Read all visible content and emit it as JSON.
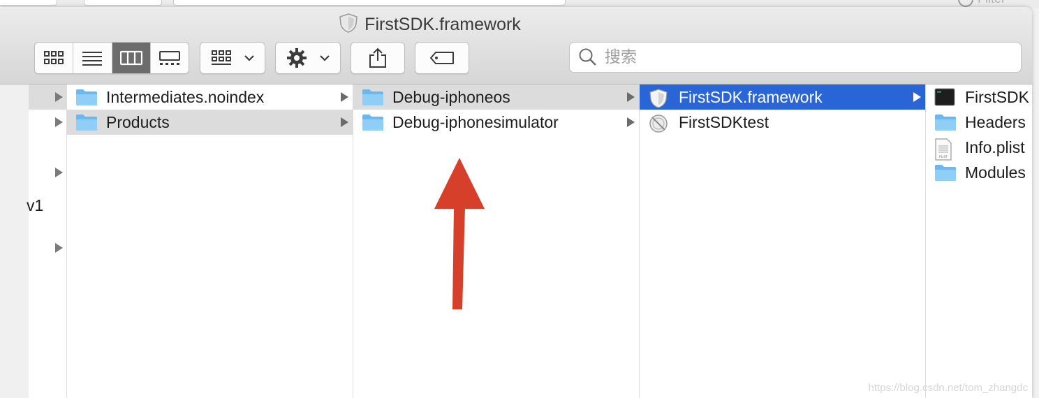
{
  "window": {
    "title": "FirstSDK.framework"
  },
  "background": {
    "filter_label": "Filter"
  },
  "toolbar": {
    "view_modes": [
      {
        "name": "icon-view",
        "active": false
      },
      {
        "name": "list-view",
        "active": false
      },
      {
        "name": "column-view",
        "active": true
      },
      {
        "name": "gallery-view",
        "active": false
      }
    ],
    "search_placeholder": "搜索"
  },
  "sidebar": {
    "partial_text": "v1"
  },
  "columns": [
    {
      "items": [
        {
          "label": "Intermediates.noindex",
          "icon": "folder-icon",
          "selected": "none",
          "expandable": true
        },
        {
          "label": "Products",
          "icon": "folder-icon",
          "selected": "grey",
          "expandable": true
        }
      ]
    },
    {
      "items": [
        {
          "label": "Debug-iphoneos",
          "icon": "folder-icon",
          "selected": "grey",
          "expandable": true
        },
        {
          "label": "Debug-iphonesimulator",
          "icon": "folder-icon",
          "selected": "none",
          "expandable": true
        }
      ]
    },
    {
      "items": [
        {
          "label": "FirstSDK.framework",
          "icon": "framework-icon",
          "selected": "blue",
          "expandable": true
        },
        {
          "label": "FirstSDKtest",
          "icon": "app-icon",
          "selected": "none",
          "expandable": false
        }
      ]
    },
    {
      "items": [
        {
          "label": "FirstSDK",
          "icon": "terminal-exec-icon",
          "selected": "none",
          "expandable": false
        },
        {
          "label": "Headers",
          "icon": "folder-icon",
          "selected": "none",
          "expandable": false
        },
        {
          "label": "Info.plist",
          "icon": "plist-icon",
          "selected": "none",
          "expandable": false
        },
        {
          "label": "Modules",
          "icon": "folder-icon",
          "selected": "none",
          "expandable": false
        }
      ]
    }
  ],
  "annotation": {
    "arrow_color": "#d6402a"
  },
  "colors": {
    "selection_blue": "#2a65d8",
    "selection_grey": "#dcdcdc",
    "folder": "#7cc3f2"
  },
  "watermark": "https://blog.csdn.net/tom_zhangdc"
}
